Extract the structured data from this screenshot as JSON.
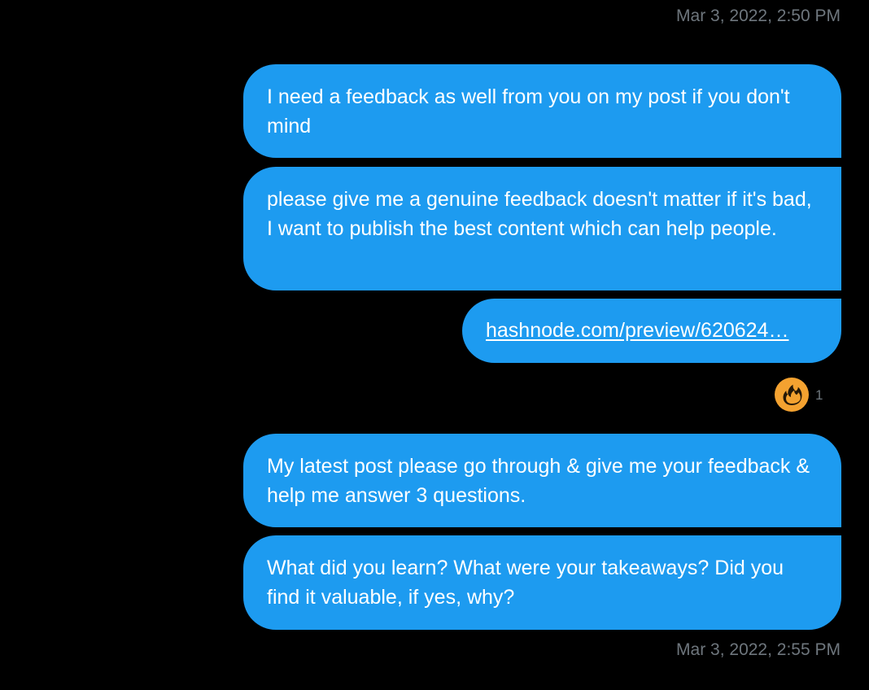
{
  "conversation": {
    "timestamp_top": "Mar 3, 2022, 2:50 PM",
    "timestamp_bottom": "Mar 3, 2022, 2:55 PM",
    "messages": [
      {
        "text": "I need a feedback as well from you on my post if you don't mind"
      },
      {
        "text": "please give me a genuine feedback doesn't matter if it's bad, I want to publish the best content which can help people."
      },
      {
        "link": "hashnode.com/preview/620624…"
      },
      {
        "text": "My latest post please go through & give me your feedback & help me answer 3 questions."
      },
      {
        "text": "What did you learn? What were your takeaways? Did you find it valuable, if yes, why?"
      }
    ],
    "reaction": {
      "icon": "fire-icon",
      "count": "1"
    }
  },
  "colors": {
    "background": "#000000",
    "bubble": "#1d9bf0",
    "bubble_text": "#ffffff",
    "meta_text": "#6e767d",
    "reaction_fire": "#f4a230"
  }
}
